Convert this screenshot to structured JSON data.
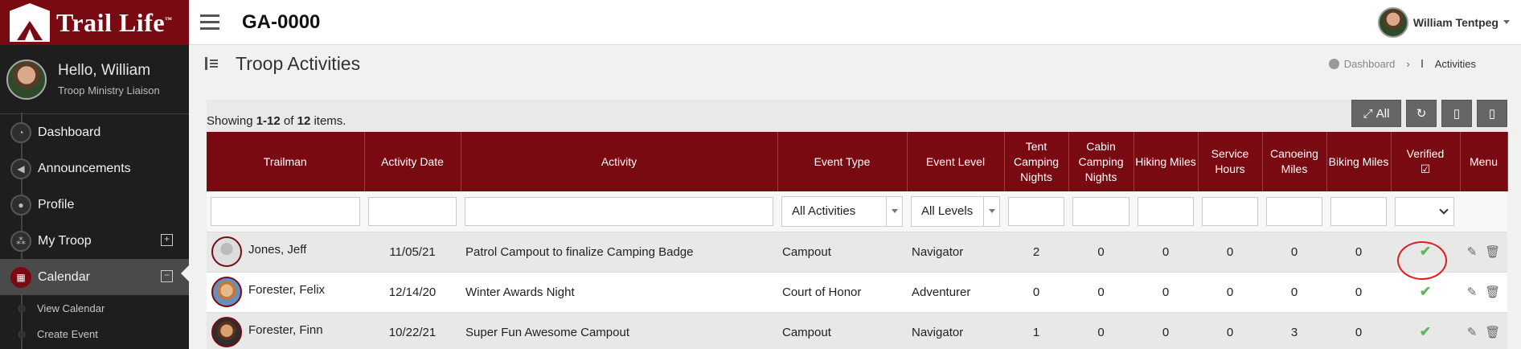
{
  "brand": {
    "name": "Trail Life",
    "tm": "™"
  },
  "user": {
    "greeting": "Hello, William",
    "role": "Troop Ministry Liaison",
    "name": "William Tentpeg"
  },
  "sidebar": {
    "items": [
      {
        "label": "Dashboard",
        "icon": "dashboard-icon"
      },
      {
        "label": "Announcements",
        "icon": "megaphone-icon"
      },
      {
        "label": "Profile",
        "icon": "user-icon"
      },
      {
        "label": "My Troop",
        "icon": "group-icon",
        "action": "+"
      },
      {
        "label": "Calendar",
        "icon": "calendar-icon",
        "action": "−",
        "active": true
      }
    ],
    "subitems": [
      {
        "label": "View Calendar"
      },
      {
        "label": "Create Event"
      }
    ]
  },
  "topbar": {
    "org": "GA-0000"
  },
  "page": {
    "title": "Troop Activities"
  },
  "breadcrumb": {
    "home": "Dashboard",
    "current": "Activities"
  },
  "summary": {
    "prefix": "Showing ",
    "range": "1-12",
    "of": " of ",
    "total": "12",
    "suffix": " items."
  },
  "tools": {
    "all_label": "All"
  },
  "columns": {
    "trailman": "Trailman",
    "date": "Activity Date",
    "activity": "Activity",
    "event_type": "Event Type",
    "event_level": "Event Level",
    "tent": "Tent Camping Nights",
    "cabin": "Cabin Camping Nights",
    "hiking": "Hiking Miles",
    "service": "Service Hours",
    "canoe": "Canoeing Miles",
    "biking": "Biking Miles",
    "verified": "Verified",
    "menu": "Menu"
  },
  "filters": {
    "event_type": "All Activities",
    "event_level": "All Levels"
  },
  "rows": [
    {
      "name": "Jones, Jeff",
      "date": "11/05/21",
      "activity": "Patrol Campout to finalize Camping Badge",
      "type": "Campout",
      "level": "Navigator",
      "tent": "2",
      "cabin": "0",
      "hiking": "0",
      "service": "0",
      "canoe": "0",
      "biking": "0"
    },
    {
      "name": "Forester, Felix",
      "date": "12/14/20",
      "activity": "Winter Awards Night",
      "type": "Court of Honor",
      "level": "Adventurer",
      "tent": "0",
      "cabin": "0",
      "hiking": "0",
      "service": "0",
      "canoe": "0",
      "biking": "0"
    },
    {
      "name": "Forester, Finn",
      "date": "10/22/21",
      "activity": "Super Fun Awesome Campout",
      "type": "Campout",
      "level": "Navigator",
      "tent": "1",
      "cabin": "0",
      "hiking": "0",
      "service": "0",
      "canoe": "3",
      "biking": "0"
    }
  ],
  "colors": {
    "brand": "#7a0a12",
    "check": "#5cb85c",
    "annotation": "#e21b1b"
  }
}
